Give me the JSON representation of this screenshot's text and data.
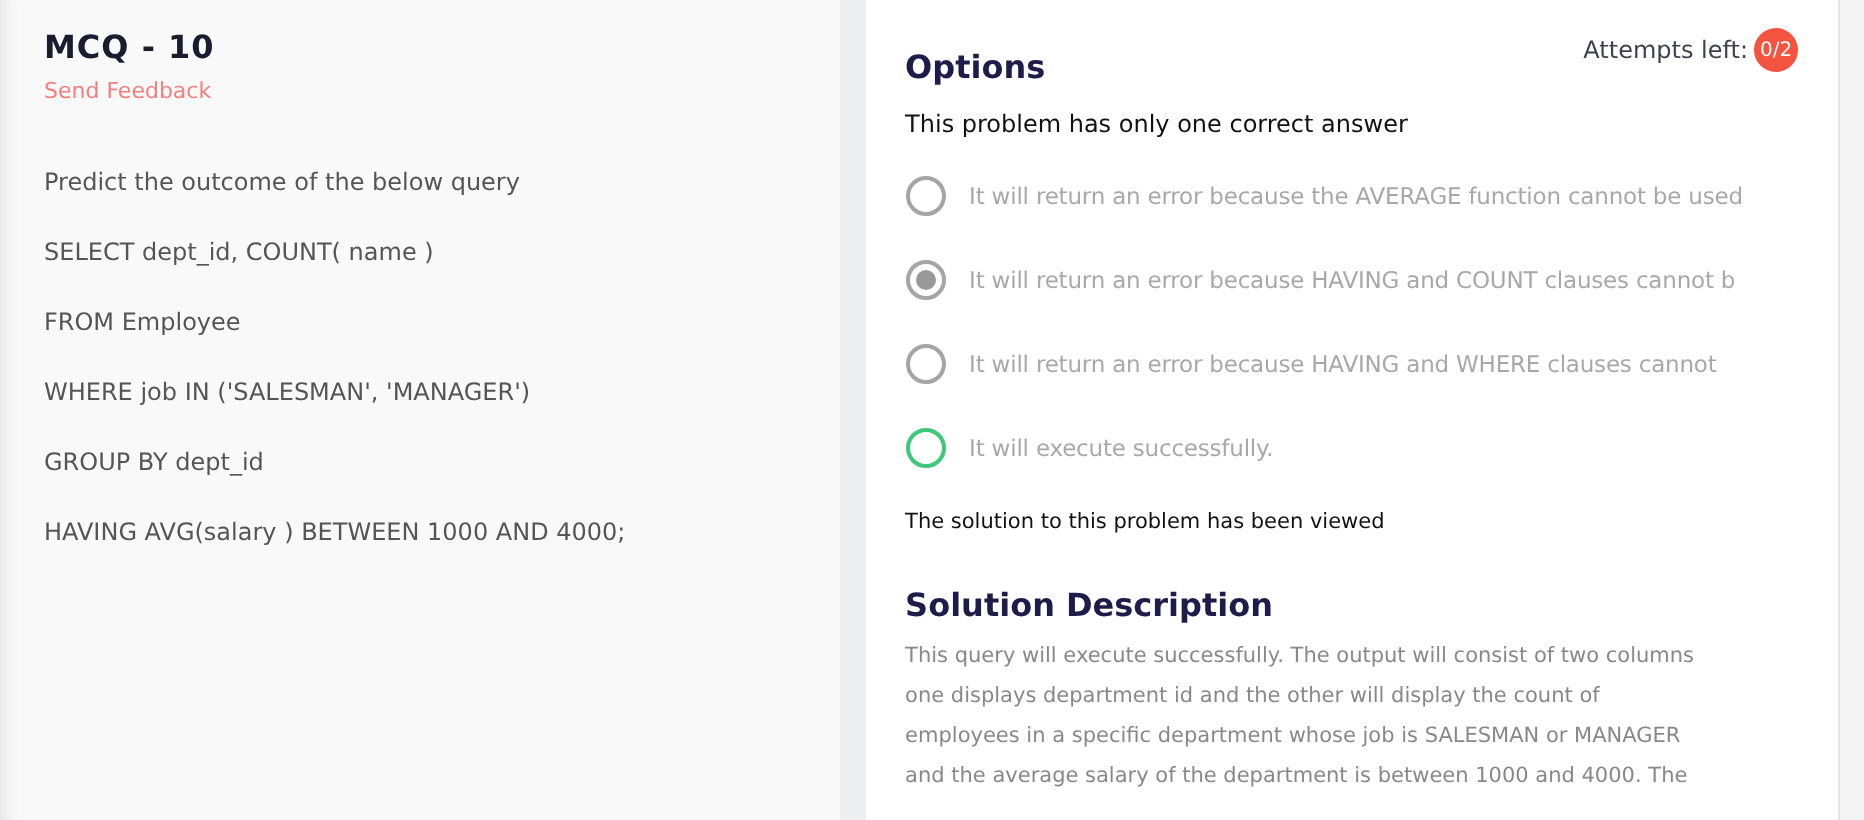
{
  "question": {
    "title": "MCQ - 10",
    "feedback_link": "Send Feedback",
    "lines": [
      "Predict the outcome of the below query",
      "SELECT dept_id, COUNT( name )",
      "FROM Employee",
      "WHERE job IN ('SALESMAN', 'MANAGER')",
      "GROUP BY dept_id",
      "HAVING AVG(salary ) BETWEEN 1000 AND 4000;"
    ]
  },
  "options_panel": {
    "title": "Options",
    "attempts_label": "Attempts left:",
    "attempts_badge": "0/2",
    "instruction": "This problem has only one correct answer",
    "options": [
      {
        "label": "It will return an error because the AVERAGE function cannot be used",
        "selected": false,
        "color": "#a5a5a5"
      },
      {
        "label": "It will return an error because HAVING and COUNT clauses cannot b",
        "selected": true,
        "color": "#a5a5a5"
      },
      {
        "label": "It will return an error because HAVING and WHERE clauses cannot",
        "selected": false,
        "color": "#a5a5a5"
      },
      {
        "label": "It will execute successfully.",
        "selected": false,
        "color": "#3ec97a"
      }
    ],
    "status": "The solution to this problem has been viewed"
  },
  "solution": {
    "title": "Solution Description",
    "lines": [
      "This query will execute successfully. The output will consist of two columns",
      "one displays department id and the other will display the count of",
      "employees in a specific department whose job is SALESMAN or MANAGER",
      "and the average salary of the department is between 1000 and 4000. The"
    ]
  }
}
